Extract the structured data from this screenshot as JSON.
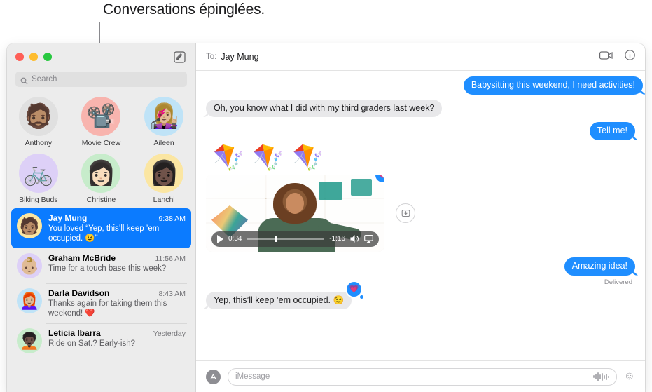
{
  "callout": {
    "caption": "Conversations épinglées."
  },
  "sidebar": {
    "search": {
      "placeholder": "Search",
      "icon": "search-icon"
    },
    "compose_icon": "compose-icon",
    "pinned": [
      {
        "name": "Anthony",
        "emoji": "🧔🏽",
        "bg": "#e0e0e0"
      },
      {
        "name": "Movie Crew",
        "emoji": "📽️",
        "bg": "#f8b4ae"
      },
      {
        "name": "Aileen",
        "emoji": "👩🏼‍🎤",
        "bg": "#bfe3f7"
      },
      {
        "name": "Biking Buds",
        "emoji": "🚲",
        "bg": "#ddd0f7"
      },
      {
        "name": "Christine",
        "emoji": "👩🏻",
        "bg": "#c7eccb"
      },
      {
        "name": "Lanchi",
        "emoji": "👩🏿",
        "bg": "#fbe6a2"
      }
    ],
    "conversations": [
      {
        "name": "Jay Mung",
        "time": "9:38 AM",
        "preview": "You loved “Yep, this’ll keep ’em occupied. 😉”",
        "emoji": "🧑🏽",
        "bg": "#fbe6a2",
        "selected": true
      },
      {
        "name": "Graham McBride",
        "time": "11:56 AM",
        "preview": "Time for a touch base this week?",
        "emoji": "👶🏼",
        "bg": "#ddd0f7",
        "selected": false
      },
      {
        "name": "Darla Davidson",
        "time": "8:43 AM",
        "preview": "Thanks again for taking them this weekend! ❤️",
        "emoji": "👩🏼‍🦰",
        "bg": "#bfe3f7",
        "selected": false
      },
      {
        "name": "Leticia Ibarra",
        "time": "Yesterday",
        "preview": "Ride on Sat.? Early-ish?",
        "emoji": "🧑🏿‍🦱",
        "bg": "#c7eccb",
        "selected": false
      }
    ]
  },
  "chat": {
    "to_label": "To:",
    "to_name": "Jay Mung",
    "facetime_icon": "video-camera-icon",
    "info_icon": "info-circle-icon",
    "messages": [
      {
        "id": "m1",
        "text": "Babysitting this weekend, I need activities!",
        "side": "out"
      },
      {
        "id": "m2",
        "text": "Oh, you know what I did with my third graders last week?",
        "side": "in"
      },
      {
        "id": "m3",
        "text": "Tell me!",
        "side": "out"
      }
    ],
    "kites": "🪁🪁🪁",
    "video": {
      "elapsed": "0:34",
      "remaining": "-1:16",
      "play_icon": "play-icon",
      "volume_icon": "volume-icon",
      "airplay_icon": "airplay-icon",
      "tapback": "💗"
    },
    "save_icon": "save-download-icon",
    "sent_message": {
      "text": "Amazing idea!",
      "status": "Delivered"
    },
    "last_message": {
      "text": "Yep, this’ll keep ’em occupied. 😉",
      "tapback": "💗"
    },
    "compose": {
      "apps_icon": "app-store-icon",
      "placeholder": "iMessage",
      "audio_icon": "audio-waveform-icon",
      "emoji_icon": "emoji-smiley-icon"
    }
  }
}
